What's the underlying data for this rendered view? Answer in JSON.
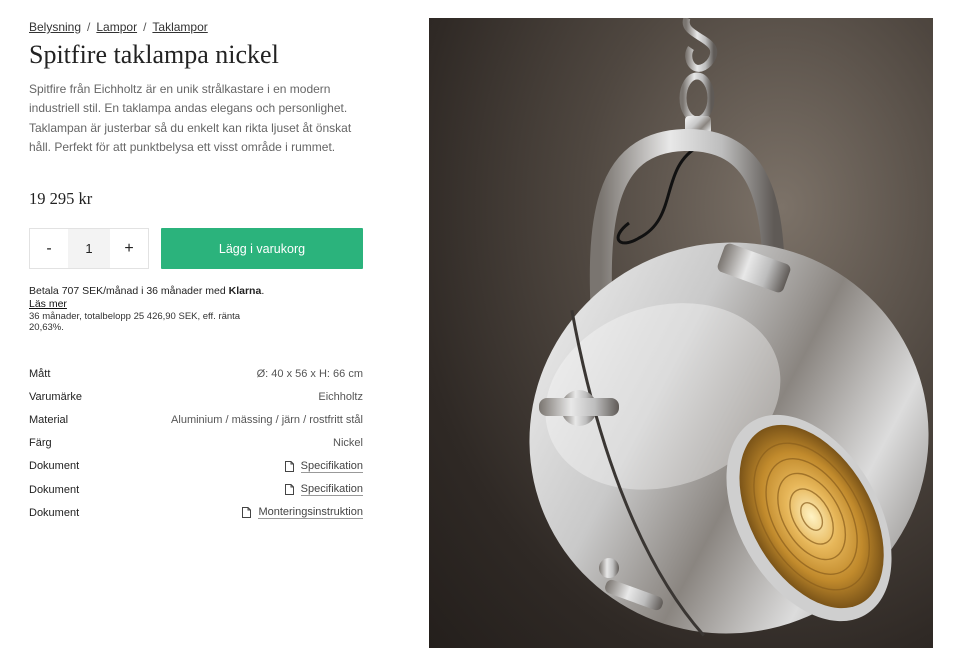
{
  "breadcrumb": [
    "Belysning",
    "Lampor",
    "Taklampor"
  ],
  "product": {
    "title": "Spitfire taklampa nickel",
    "description": "Spitfire från Eichholtz är en unik strålkastare i en modern industriell stil. En taklampa andas elegans och personlighet. Taklampan är justerbar så du enkelt kan rikta ljuset åt önskat håll. Perfekt för att punktbelysa ett visst område i rummet.",
    "price": "19 295 kr"
  },
  "cart": {
    "minus": "-",
    "plus": "+",
    "quantity": "1",
    "add_label": "Lägg i varukorg",
    "accent": "#2bb37c"
  },
  "klarna": {
    "text_before": "Betala 707 SEK/månad i 36 månader med ",
    "brand": "Klarna",
    "text_after": ".",
    "read_more": "Läs mer",
    "fine_print": "36 månader, totalbelopp 25 426,90 SEK, eff. ränta 20,63%."
  },
  "specs": [
    {
      "label": "Mått",
      "value": "Ø: 40 x 56 x H: 66 cm"
    },
    {
      "label": "Varumärke",
      "value": "Eichholtz"
    },
    {
      "label": "Material",
      "value": "Aluminium / mässing / järn / rostfritt stål"
    },
    {
      "label": "Färg",
      "value": "Nickel"
    },
    {
      "label": "Dokument",
      "value": "Specifikation",
      "icon": "document-icon"
    },
    {
      "label": "Dokument",
      "value": "Specifikation",
      "icon": "document-icon"
    },
    {
      "label": "Dokument",
      "value": "Monteringsinstruktion",
      "icon": "document-icon"
    }
  ],
  "image": {
    "subject": "chrome-spotlight-pendant-lamp"
  }
}
